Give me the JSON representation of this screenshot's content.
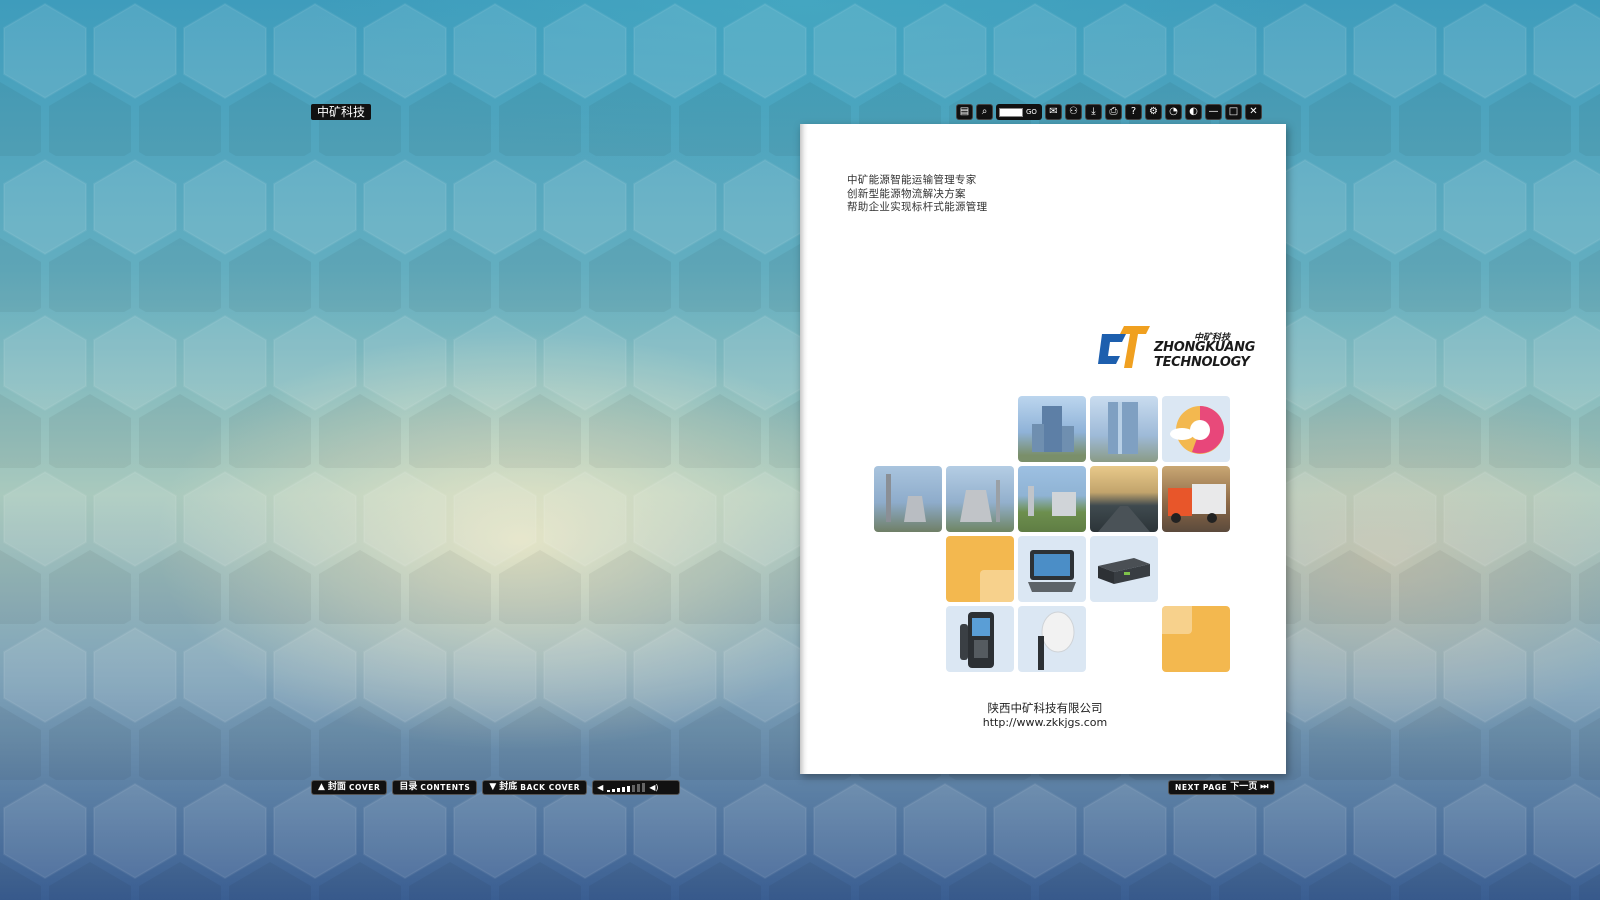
{
  "app": {
    "brand_tag": "中矿科技"
  },
  "toolbar": {
    "buttons": [
      {
        "icon": "thumbnails-icon",
        "glyph": "▤"
      },
      {
        "icon": "zoom-icon",
        "glyph": "⌕"
      },
      {
        "icon": "comment-icon",
        "glyph": "✉"
      },
      {
        "icon": "share-icon",
        "glyph": "⚇"
      },
      {
        "icon": "download-icon",
        "glyph": "⤓"
      },
      {
        "icon": "print-icon",
        "glyph": "⎙"
      },
      {
        "icon": "help-icon",
        "glyph": "?"
      },
      {
        "icon": "settings-icon",
        "glyph": "⚙"
      },
      {
        "icon": "autoplay-icon",
        "glyph": "◔"
      },
      {
        "icon": "color-icon",
        "glyph": "◐"
      },
      {
        "icon": "minimize-icon",
        "glyph": "—"
      },
      {
        "icon": "maximize-icon",
        "glyph": "□"
      },
      {
        "icon": "close-icon",
        "glyph": "✕"
      }
    ],
    "goto_label": "GO",
    "goto_value": ""
  },
  "page": {
    "tagline": [
      "中矿能源智能运输管理专家",
      "创新型能源物流解决方案",
      "帮助企业实现标杆式能源管理"
    ],
    "logo": {
      "cn": "中矿科技",
      "en_line1": "ZHONGKUANG",
      "en_line2": "TECHNOLOGY"
    },
    "company_name": "陕西中矿科技有限公司",
    "company_url": "http://www.zkkjgs.com"
  },
  "bottom_nav": {
    "cover": {
      "cn": "封面",
      "en": "COVER"
    },
    "contents": {
      "cn": "目录",
      "en": "CONTENTS"
    },
    "back_cover": {
      "cn": "封底",
      "en": "BACK COVER"
    },
    "next_page": {
      "en": "NEXT PAGE",
      "cn": "下一页"
    },
    "volume_level": 0.6
  },
  "colors": {
    "accent_orange": "#f3b84f",
    "tile_blue": "#dbe7f3",
    "logo_blue": "#1d5fae",
    "logo_orange": "#f0a020"
  }
}
